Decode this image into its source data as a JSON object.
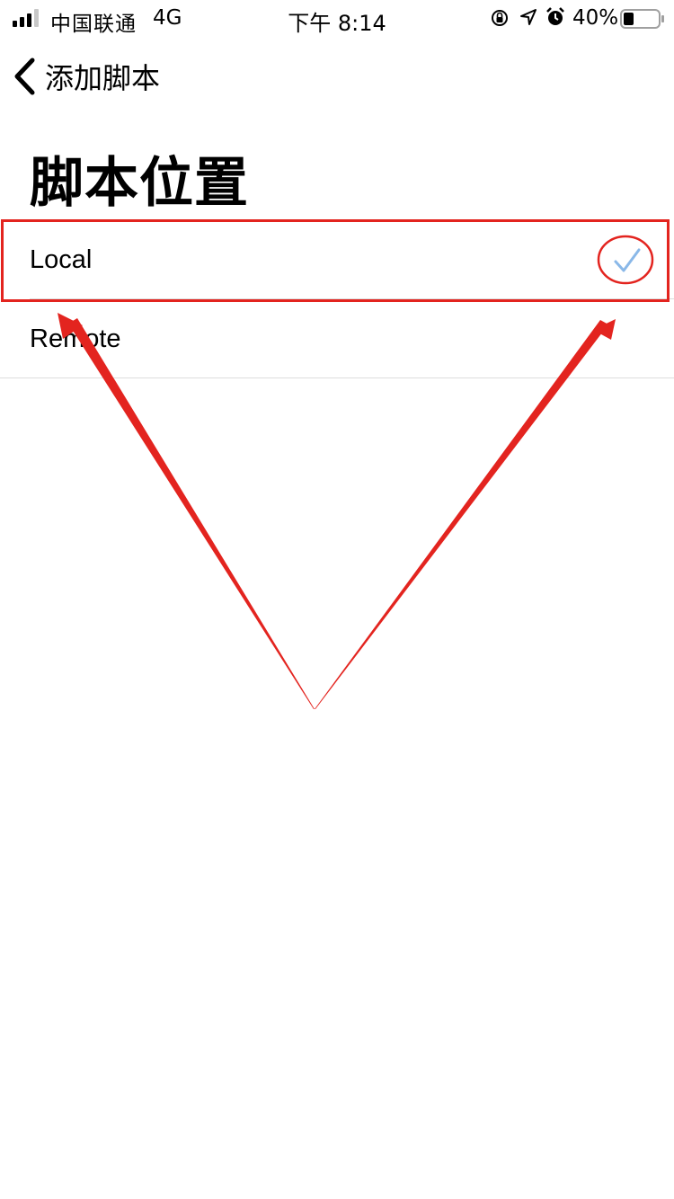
{
  "status_bar": {
    "carrier": "中国联通",
    "network": "4G",
    "time": "下午 8:14",
    "battery": "40%"
  },
  "nav": {
    "back_label": "添加脚本"
  },
  "page": {
    "title": "脚本位置"
  },
  "options": [
    {
      "label": "Local",
      "selected": true
    },
    {
      "label": "Remote",
      "selected": false
    }
  ],
  "colors": {
    "checkmark": "#8ab8e8",
    "annotation": "#e3241f"
  },
  "icons": [
    "signal-icon",
    "orientation-lock-icon",
    "location-icon",
    "alarm-icon",
    "battery-icon",
    "chevron-left-icon",
    "checkmark-icon"
  ]
}
